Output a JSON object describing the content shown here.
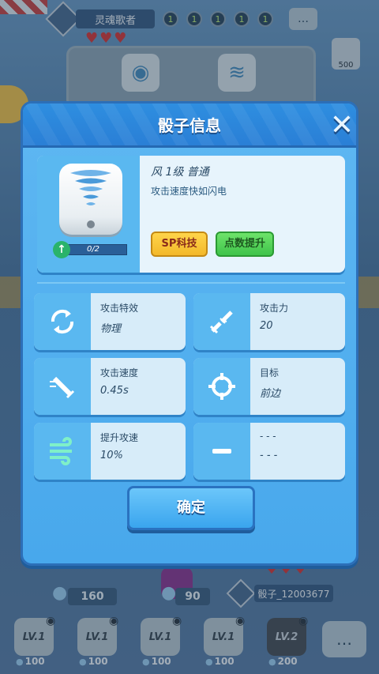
{
  "background": {
    "player_name": "灵魂歌者",
    "sp_counters": [
      "1",
      "1",
      "1",
      "1",
      "1"
    ],
    "top_right_value": "500",
    "player_resource": "160",
    "center_resource": "90",
    "opponent_name": "骰子_12003677",
    "deck": [
      {
        "level": "LV.1",
        "cost": "100"
      },
      {
        "level": "LV.1",
        "cost": "100"
      },
      {
        "level": "LV.1",
        "cost": "100"
      },
      {
        "level": "LV.1",
        "cost": "100"
      },
      {
        "level": "LV.2",
        "cost": "200"
      }
    ]
  },
  "modal": {
    "title": "骰子信息",
    "dice": {
      "name_line": "风  1级  普通",
      "description": "攻击速度快如闪电",
      "progress_text": "0/2",
      "progress_fraction": 0
    },
    "buttons": {
      "sp_tech": "SP科技",
      "pip_upgrade": "点数提升",
      "confirm": "确定"
    },
    "stats": [
      {
        "label": "攻击特效",
        "value": "物理",
        "icon": "swirl-arrows-icon"
      },
      {
        "label": "攻击力",
        "value": "20",
        "icon": "broken-sword-icon"
      },
      {
        "label": "攻击速度",
        "value": "0.45s",
        "icon": "sword-speed-icon"
      },
      {
        "label": "目标",
        "value": "前边",
        "icon": "crosshair-icon"
      },
      {
        "label": "提升攻速",
        "value": "10%",
        "icon": "wind-icon"
      },
      {
        "label": "- - -",
        "value": "- - -",
        "icon": "dash-icon"
      }
    ]
  },
  "colors": {
    "modal_blue": "#48a8ec",
    "header_blue": "#2a7fd6",
    "sp_yellow": "#f3b82a",
    "pip_green": "#3fc34a"
  }
}
